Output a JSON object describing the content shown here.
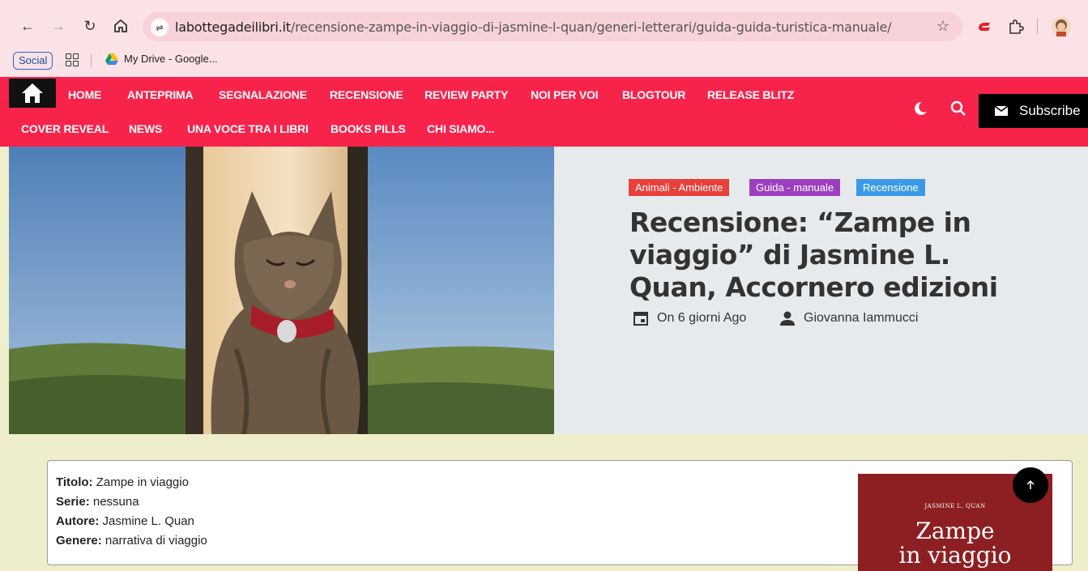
{
  "browser": {
    "url_domain": "labottegadeilibri.it",
    "url_path": "/recensione-zampe-in-viaggio-di-jasmine-l-quan/generi-letterari/guida-guida-turistica-manuale/",
    "bookmarks": [
      {
        "label": "Social"
      },
      {
        "label": "My Drive - Google..."
      }
    ]
  },
  "nav": {
    "row1": [
      "HOME",
      "ANTEPRIMA",
      "SEGNALAZIONE",
      "RECENSIONE",
      "REVIEW PARTY",
      "NOI PER VOI",
      "BLOGTOUR",
      "RELEASE BLITZ"
    ],
    "row2": [
      "COVER REVEAL",
      "NEWS",
      "UNA VOCE TRA I LIBRI",
      "BOOKS PILLS",
      "CHI SIAMO..."
    ],
    "subscribe_label": "Subscribe"
  },
  "post": {
    "categories": [
      {
        "label": "Animali - Ambiente",
        "color": "#e8403a"
      },
      {
        "label": "Guida - manuale",
        "color": "#9b3fc0"
      },
      {
        "label": "Recensione",
        "color": "#3a9ae8"
      }
    ],
    "title": "Recensione: “Zampe in viaggio” di Jasmine L. Quan, Accornero edizioni",
    "date": "On 6 giorni Ago",
    "author": "Giovanna Iammucci"
  },
  "book_info": [
    {
      "key": "Titolo:",
      "value": " Zampe in viaggio"
    },
    {
      "key": "Serie:",
      "value": " nessuna"
    },
    {
      "key": "Autore:",
      "value": " Jasmine L. Quan"
    },
    {
      "key": "Genere:",
      "value": " narrativa di viaggio"
    }
  ],
  "cover": {
    "author": "JASMINE L. QUAN",
    "title_line1": "Zampe",
    "title_line2": "in viaggio"
  },
  "colors": {
    "nav_bg": "#f8234a",
    "chrome_bg": "#fbe2e6",
    "page_bg": "#efeecb"
  }
}
